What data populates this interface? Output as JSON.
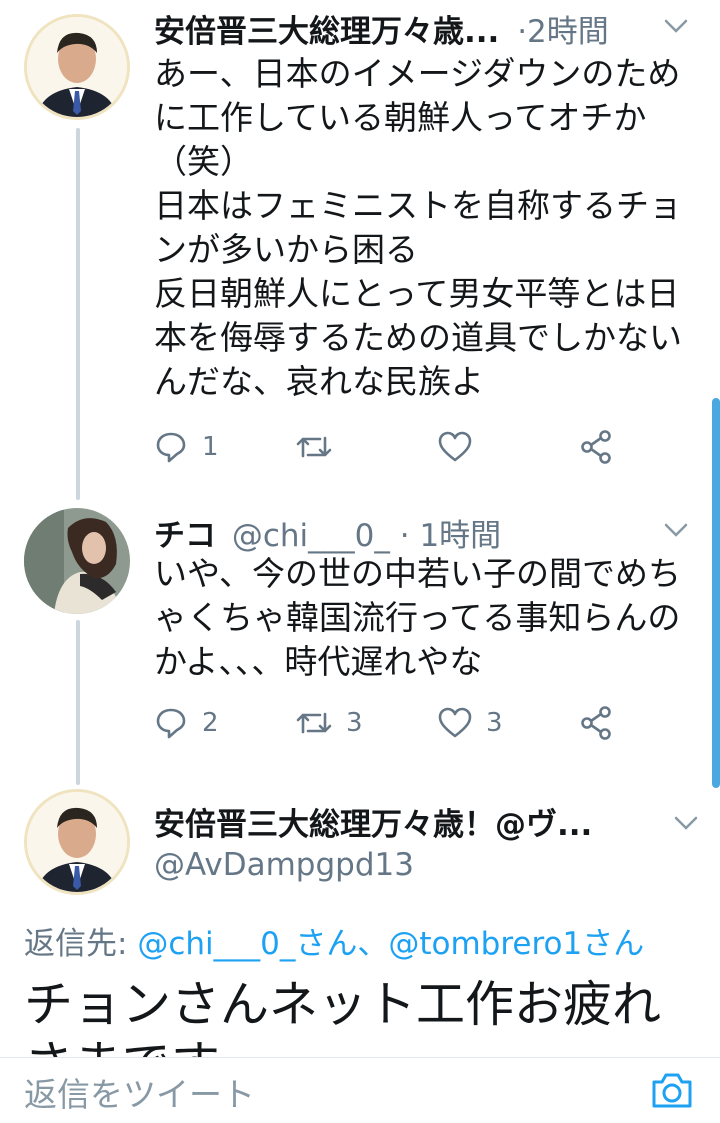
{
  "colors": {
    "accent": "#1da1f2",
    "muted": "#657786",
    "thread_line": "#ccd6dd"
  },
  "tweets": [
    {
      "name": "安倍晋三大総理万々歳...",
      "time": "·2時間",
      "avatar_icon": "abe-photo-avatar",
      "lines": [
        "あー、日本のイメージダウンのため",
        "に工作している朝鮮人ってオチか",
        "（笑）",
        "日本はフェミニストを自称するチョ",
        "ンが多いから困る",
        "反日朝鮮人にとって男女平等とは日",
        "本を侮辱するための道具でしかない",
        "んだな、哀れな民族よ"
      ],
      "reply_count": "1",
      "retweet_count": "",
      "like_count": ""
    },
    {
      "name": "チコ",
      "handle_time": "@chi___0_ · 1時間",
      "avatar_icon": "woman-photo-avatar",
      "lines": [
        "いや、今の世の中若い子の間でめち",
        "ゃくちゃ韓国流行ってる事知らんの",
        "かよ、、、時代遅れやな"
      ],
      "reply_count": "2",
      "retweet_count": "3",
      "like_count": "3"
    }
  ],
  "focused": {
    "name": "安倍晋三大総理万々歳！@ヴ...",
    "handle": "@AvDampgpd13",
    "reply_to_label": "返信先:",
    "reply_to_users": "@chi___0_さん、@tombrero1さん",
    "text": "チョンさんネット工作お疲れ",
    "text_cut": "さまです"
  },
  "composer": {
    "placeholder": "返信をツイート",
    "icon": "camera-icon"
  }
}
